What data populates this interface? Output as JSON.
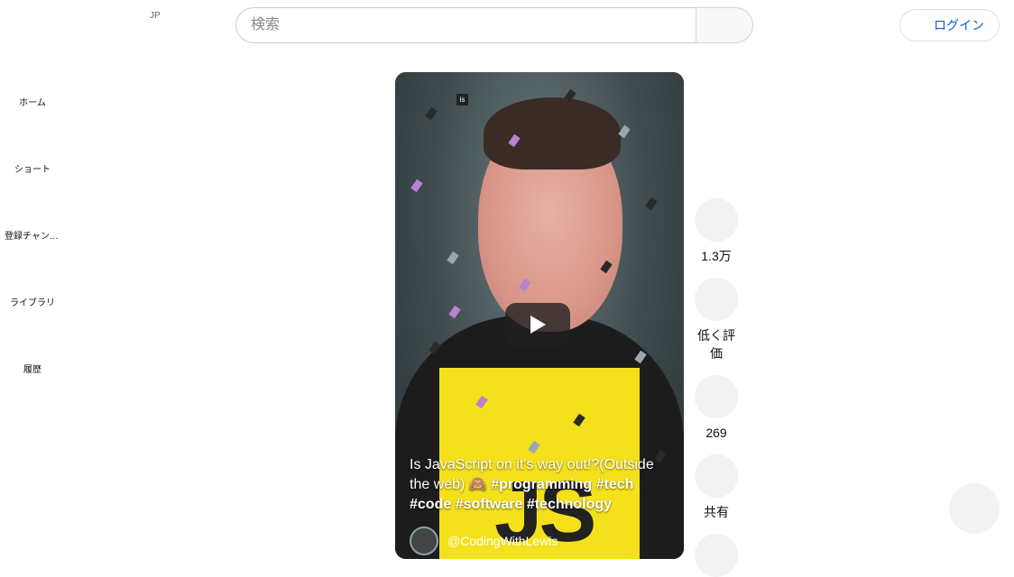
{
  "header": {
    "country_code": "JP",
    "search_placeholder": "検索",
    "login_label": "ログイン"
  },
  "sidebar": {
    "items": [
      {
        "label": "ホーム"
      },
      {
        "label": "ショート"
      },
      {
        "label": "登録チャンネル"
      },
      {
        "label": "ライブラリ"
      },
      {
        "label": "履歴"
      }
    ]
  },
  "video": {
    "badge_text": "is",
    "logo_text": "JS",
    "caption_plain": "Is JavaScript on it's way out!?(Outside the web) 🙈 ",
    "caption_tags": "#programming #tech #code #software #technology",
    "channel_name": "@CodingWithLewis"
  },
  "actions": {
    "like_count": "1.3万",
    "dislike_label": "低く評価",
    "comment_count": "269",
    "share_label": "共有"
  },
  "colors": {
    "link_blue": "#065fd4",
    "js_yellow": "#f4e11b"
  }
}
